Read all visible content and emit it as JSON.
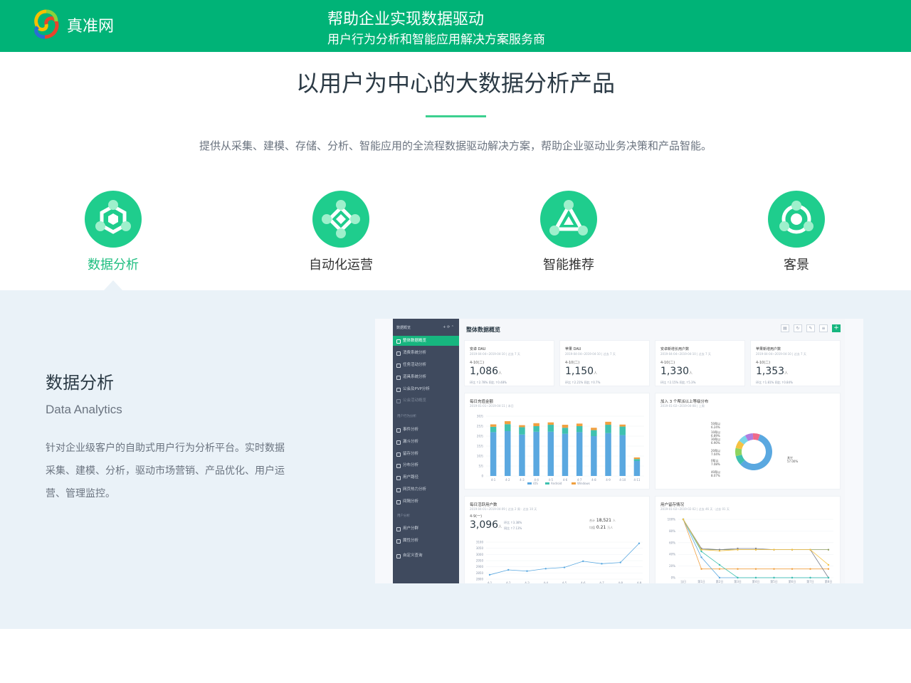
{
  "header": {
    "logo_text": "真准网",
    "tagline_main": "帮助企业实现数据驱动",
    "tagline_sub": "用户行为分析和智能应用解决方案服务商",
    "color": "#00b377"
  },
  "intro": {
    "title": "以用户为中心的大数据分析产品",
    "description": "提供从采集、建模、存储、分析、智能应用的全流程数据驱动解决方案，帮助企业驱动业务决策和产品智能。"
  },
  "features": [
    {
      "label": "数据分析",
      "icon": "hexagon-network-icon",
      "active": true
    },
    {
      "label": "自动化运营",
      "icon": "diamond-network-icon",
      "active": false
    },
    {
      "label": "智能推荐",
      "icon": "triangle-network-icon",
      "active": false
    },
    {
      "label": "客景",
      "icon": "circle-network-icon",
      "active": false
    }
  ],
  "section": {
    "title": "数据分析",
    "title_en": "Data Analytics",
    "description": "针对企业级客户的自助式用户行为分析平台。实时数据采集、建模、分析，驱动市场营销、产品优化、用户运营、管理监控。"
  },
  "dashboard": {
    "sidebar_header": "数据概览",
    "sidebar_items": [
      {
        "label": "整体数据概览",
        "active": true
      },
      {
        "label": "消费系统分析"
      },
      {
        "label": "任务活动分析"
      },
      {
        "label": "道具系统分析"
      },
      {
        "label": "公会及PVP分析"
      },
      {
        "label": "公会活动概览",
        "dim": true
      }
    ],
    "group1": "用户行为分析",
    "group1_items": [
      "事件分析",
      "漏斗分析",
      "留存分析",
      "分布分析",
      "用户路径",
      "网页热力分析",
      "间隔分析"
    ],
    "group2": "用户分析",
    "group2_items": [
      "用户分群",
      "属性分析"
    ],
    "extra_item": "自定义查询",
    "page_title": "整体数据概览",
    "kpis": [
      {
        "title": "安卓 DAU",
        "date": "2019-04-04~2019-04-10 | 过去 7 天",
        "period": "4-10(二)",
        "value": "1,086",
        "unit": "人",
        "compare": "环比 ↑2.78%  同比 ↑0.48%"
      },
      {
        "title": "苹果 DAU",
        "date": "2019-04-04~2019-04-10 | 过去 7 天",
        "period": "4-10(二)",
        "value": "1,150",
        "unit": "人",
        "compare": "环比 ↑2.21%  同比 ↑0.7%"
      },
      {
        "title": "安卓新增长用户数",
        "date": "2019-04-04~2019-04-10 | 过去 7 天",
        "period": "4-10(二)",
        "value": "1,330",
        "unit": "人",
        "compare": "环比 ↑2.15%  同比 ↑5.3%"
      },
      {
        "title": "苹果新增用户数",
        "date": "2019-04-04~2019-04-10 | 过去 7 天",
        "period": "4-10(二)",
        "value": "1,353",
        "unit": "人",
        "compare": "环比 ↑1.81%  同比 ↑0.84%"
      }
    ],
    "bar_card": {
      "title": "每日充值金额",
      "date": "2019-01-01~2019-04-11 | 本日"
    },
    "donut_card": {
      "title": "加入 3 个帮派以上等级分布",
      "date": "2019-01-02~2019-04-08 | 上周"
    },
    "line_card": {
      "title": "每日活跃用户数",
      "date": "2019-04-01~2019-04-09 | 过去 2 周 · 过去 10 天",
      "period": "4-9(一)",
      "value": "3,096",
      "unit": "人",
      "compare1": "环比 ↑3.38%",
      "compare2": "同比 ↑7.13%",
      "total_label": "合计",
      "total_value": "18,521",
      "total_unit": "人",
      "avg_label": "均值",
      "avg_value": "0.21",
      "avg_unit": "万人"
    },
    "retention_card": {
      "title": "用户留存情况",
      "date": "2019-01-02~2019-02-02 | 过去 46 天 · 过去 01 天"
    }
  },
  "chart_data": [
    {
      "type": "bar",
      "title": "每日充值金额",
      "categories": [
        "4-1",
        "4-2",
        "4-3",
        "4-4",
        "4-5",
        "4-6",
        "4-7",
        "4-8",
        "4-9",
        "4-10",
        "4-11"
      ],
      "ylim": [
        0,
        300000
      ],
      "yticks": [
        "0",
        "5万",
        "10万",
        "15万",
        "20万",
        "25万",
        "30万"
      ],
      "series": [
        {
          "name": "iOS",
          "color": "#5aa8e0",
          "values": [
            220000,
            225000,
            208000,
            222000,
            222000,
            212000,
            220000,
            200000,
            215000,
            205000,
            75000
          ]
        },
        {
          "name": "Android",
          "color": "#3fc1b0",
          "values": [
            27000,
            35000,
            37000,
            28000,
            35000,
            30000,
            30000,
            30000,
            42000,
            43000,
            10000
          ]
        },
        {
          "name": "Windows",
          "color": "#f0a040",
          "values": [
            12000,
            15000,
            10000,
            15000,
            12000,
            15000,
            13000,
            12000,
            15000,
            10000,
            8000
          ]
        }
      ]
    },
    {
      "type": "pie",
      "title": "加入 3 个帮派以上等级分布",
      "series": [
        {
          "name": "其它",
          "value": 57.0,
          "color": "#5aa8e0"
        },
        {
          "name": "40帮以",
          "value": 8.07,
          "color": "#3fc1b0"
        },
        {
          "name": "0帮以",
          "value": 7.08,
          "color": "#8ed45f"
        },
        {
          "name": "20帮以",
          "value": 7.04,
          "color": "#f5c242"
        },
        {
          "name": "30帮以",
          "value": 6.9,
          "color": "#7ad6e8"
        },
        {
          "name": "10帮以",
          "value": 6.89,
          "color": "#b07ce0"
        },
        {
          "name": "50帮以",
          "value": 6.24,
          "color": "#f06a8a"
        }
      ]
    },
    {
      "type": "line",
      "title": "每日活跃用户数",
      "categories": [
        "4-1",
        "4-2",
        "4-3",
        "4-4",
        "4-5",
        "4-6",
        "4-7",
        "4-8",
        "4-9"
      ],
      "yticks": [
        "2800",
        "2850",
        "2900",
        "2950",
        "3000",
        "3050",
        "3100"
      ],
      "ylim": [
        2800,
        3100
      ],
      "series": [
        {
          "name": "活跃用户数",
          "color": "#5aa8e0",
          "values": [
            2835,
            2875,
            2865,
            2885,
            2895,
            2945,
            2925,
            2935,
            3090
          ]
        }
      ]
    },
    {
      "type": "line",
      "title": "用户留存情况",
      "categories": [
        "当日",
        "第1日",
        "第2日",
        "第3日",
        "第4日",
        "第5日",
        "第6日",
        "第7日",
        "第8日"
      ],
      "ylim": [
        0,
        100
      ],
      "yticks": [
        "0%",
        "20%",
        "40%",
        "60%",
        "80%",
        "100%"
      ],
      "series": [
        {
          "name": "A",
          "color": "#8a9a5b",
          "values": [
            100,
            48,
            48,
            48,
            48,
            48,
            48,
            48,
            48
          ]
        },
        {
          "name": "B",
          "color": "#f0a040",
          "values": [
            100,
            15,
            15,
            15,
            15,
            15,
            15,
            15,
            15
          ]
        },
        {
          "name": "C",
          "color": "#5aa8e0",
          "values": [
            100,
            35,
            0,
            0,
            0,
            0,
            0,
            0,
            0
          ]
        },
        {
          "name": "D",
          "color": "#7a7f8c",
          "values": [
            100,
            50,
            48,
            50,
            50,
            48,
            48,
            48,
            0
          ]
        },
        {
          "name": "E",
          "color": "#3fc1b0",
          "values": [
            100,
            45,
            22,
            0,
            0,
            0,
            0,
            0,
            0
          ]
        },
        {
          "name": "F",
          "color": "#f5c242",
          "values": [
            100,
            48,
            46,
            48,
            48,
            48,
            48,
            48,
            22
          ]
        }
      ]
    }
  ]
}
